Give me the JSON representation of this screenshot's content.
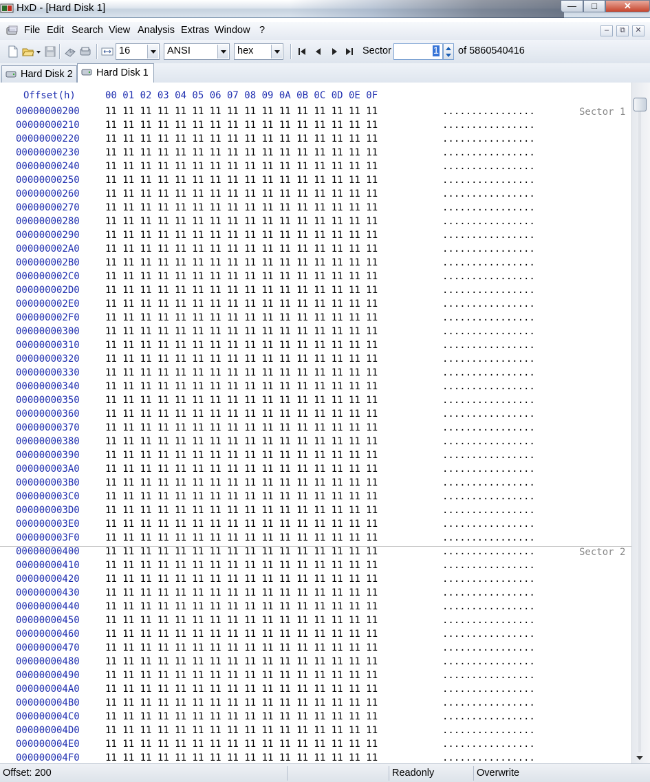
{
  "window": {
    "title": "HxD - [Hard Disk 1]"
  },
  "menu": [
    "File",
    "Edit",
    "Search",
    "View",
    "Analysis",
    "Extras",
    "Window",
    "?"
  ],
  "toolbar": {
    "bytes_per_row": "16",
    "charset": "ANSI",
    "offset_base": "hex",
    "sector_label": "Sector",
    "sector_value": "1",
    "sector_total": "of 5860540416"
  },
  "tabs": [
    {
      "label": "Hard Disk 2",
      "active": false
    },
    {
      "label": "Hard Disk 1",
      "active": true
    }
  ],
  "editor": {
    "offset_header": "Offset(h)",
    "column_header": "00 01 02 03 04 05 06 07 08 09 0A 0B 0C 0D 0E 0F",
    "hex_line": "11 11 11 11 11 11 11 11 11 11 11 11 11 11 11 11",
    "ascii_line": "................",
    "sector_marks": [
      "Sector 1",
      "Sector 2"
    ],
    "offsets": [
      "00000000200",
      "00000000210",
      "00000000220",
      "00000000230",
      "00000000240",
      "00000000250",
      "00000000260",
      "00000000270",
      "00000000280",
      "00000000290",
      "000000002A0",
      "000000002B0",
      "000000002C0",
      "000000002D0",
      "000000002E0",
      "000000002F0",
      "00000000300",
      "00000000310",
      "00000000320",
      "00000000330",
      "00000000340",
      "00000000350",
      "00000000360",
      "00000000370",
      "00000000380",
      "00000000390",
      "000000003A0",
      "000000003B0",
      "000000003C0",
      "000000003D0",
      "000000003E0",
      "000000003F0",
      "00000000400",
      "00000000410",
      "00000000420",
      "00000000430",
      "00000000440",
      "00000000450",
      "00000000460",
      "00000000470",
      "00000000480",
      "00000000490",
      "000000004A0",
      "000000004B0",
      "000000004C0",
      "000000004D0",
      "000000004E0",
      "000000004F0"
    ]
  },
  "status": {
    "offset": "Offset: 200",
    "mode": "Readonly",
    "insert_mode": "Overwrite"
  }
}
